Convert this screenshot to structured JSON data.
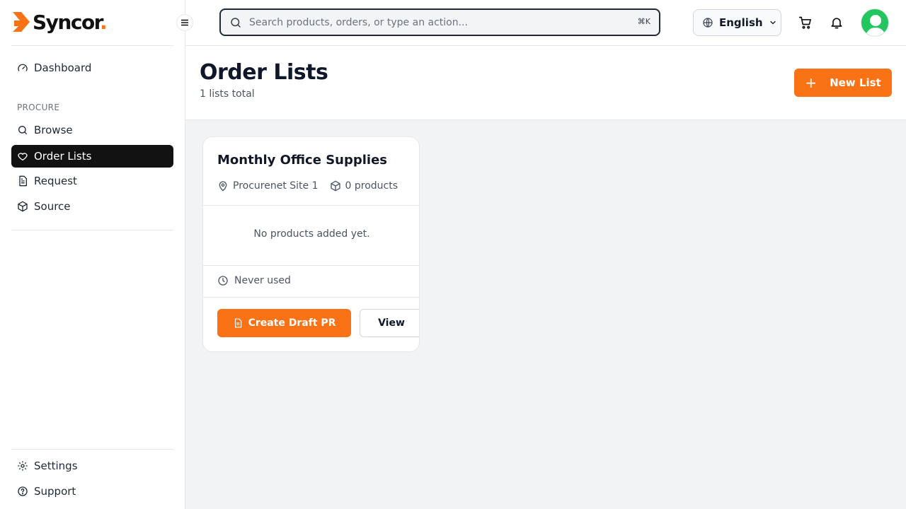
{
  "brand": {
    "name": "Syncor",
    "dot": ".",
    "accent": "#f97316"
  },
  "sidebar": {
    "dashboard": {
      "label": "Dashboard",
      "icon": "gauge-icon"
    },
    "section_label": "PROCURE",
    "items": [
      {
        "label": "Browse",
        "icon": "search-icon"
      },
      {
        "label": "Order Lists",
        "icon": "heart-icon",
        "active": true
      },
      {
        "label": "Request",
        "icon": "document-icon"
      },
      {
        "label": "Source",
        "icon": "package-icon"
      }
    ],
    "bottom": [
      {
        "label": "Settings",
        "icon": "gear-icon"
      },
      {
        "label": "Support",
        "icon": "help-icon"
      }
    ]
  },
  "header": {
    "search_placeholder": "Search products, orders, or type an action...",
    "search_shortcut": "⌘K",
    "language": "English"
  },
  "page": {
    "title": "Order Lists",
    "subtitle": "1 lists total",
    "new_list_label": "New List"
  },
  "lists": [
    {
      "title": "Monthly Office Supplies",
      "site": "Procurenet Site 1",
      "products": "0 products",
      "empty_text": "No products added yet.",
      "last_used": "Never used",
      "primary_action": "Create Draft PR",
      "secondary_action": "View"
    }
  ]
}
